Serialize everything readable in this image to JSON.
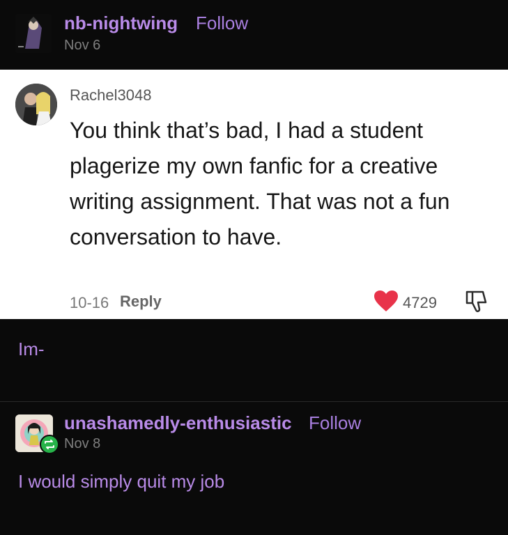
{
  "post1": {
    "username": "nb-nightwing",
    "follow_label": "Follow",
    "date": "Nov 6"
  },
  "comment": {
    "username": "Rachel3048",
    "text": "You think that’s bad, I had a student plagerize my own fanfic for a creative writing assignment. That was not a fun conversation to have.",
    "date": "10-16",
    "reply_label": "Reply",
    "likes": "4729"
  },
  "post1_body": "Im-",
  "post2": {
    "username": "unashamedly-enthusiastic",
    "follow_label": "Follow",
    "date": "Nov 8",
    "text": "I would simply quit my job"
  },
  "colors": {
    "accent": "#b98be8",
    "heart": "#e8334a",
    "background": "#0a0a0a",
    "reblog": "#27b34a"
  },
  "icons": {
    "like": "heart-icon",
    "dislike": "thumbs-down-icon",
    "reblog": "reblog-icon"
  }
}
